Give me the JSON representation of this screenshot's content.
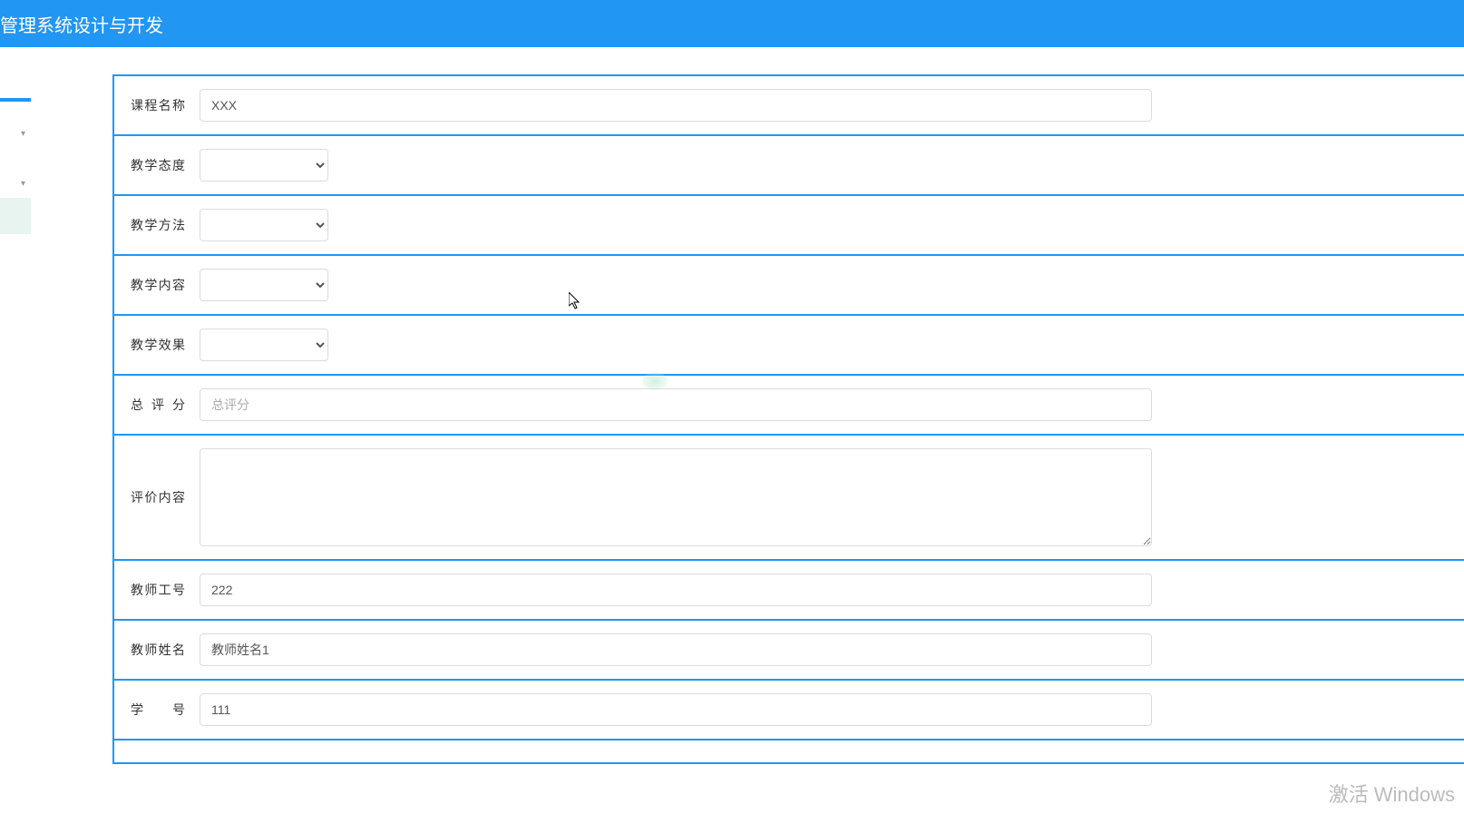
{
  "header": {
    "title": "管理系统设计与开发"
  },
  "form": {
    "course_name": {
      "label": "课程名称",
      "value": "XXX"
    },
    "teaching_attitude": {
      "label": "教学态度",
      "value": ""
    },
    "teaching_method": {
      "label": "教学方法",
      "value": ""
    },
    "teaching_content": {
      "label": "教学内容",
      "value": ""
    },
    "teaching_effect": {
      "label": "教学效果",
      "value": ""
    },
    "total_score": {
      "label": "总评分",
      "placeholder": "总评分",
      "value": ""
    },
    "evaluation_content": {
      "label": "评价内容",
      "value": ""
    },
    "teacher_id": {
      "label": "教师工号",
      "value": "222"
    },
    "teacher_name": {
      "label": "教师姓名",
      "value": "教师姓名1"
    },
    "student_id": {
      "label": "学号",
      "value": "111"
    }
  },
  "watermark": "激活 Windows"
}
